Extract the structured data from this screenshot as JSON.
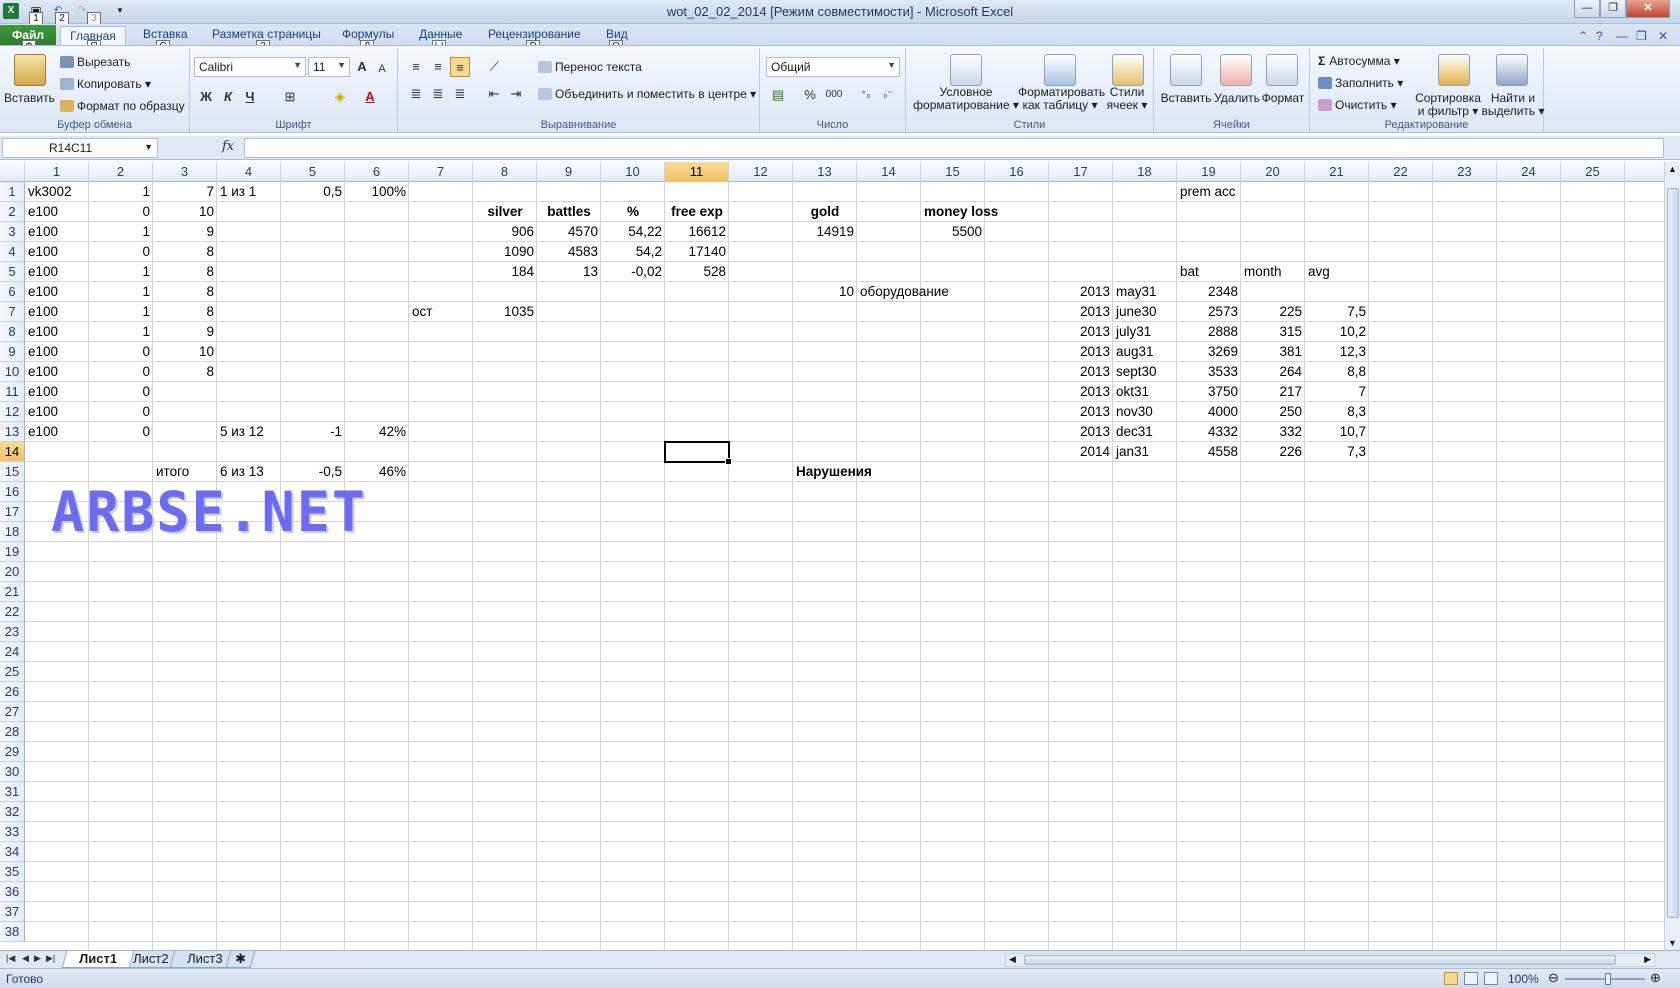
{
  "window": {
    "title": "wot_02_02_2014  [Режим совместимости]  -  Microsoft Excel",
    "qa_keytips": [
      "1",
      "2",
      "3"
    ],
    "minimize": "—",
    "restore": "❐",
    "close": "✕"
  },
  "tabs": [
    {
      "label": "Файл",
      "keytip": "Ф"
    },
    {
      "label": "Главная",
      "keytip": "Я"
    },
    {
      "label": "Вставка",
      "keytip": "С"
    },
    {
      "label": "Разметка страницы",
      "keytip": "З"
    },
    {
      "label": "Формулы",
      "keytip": "Л"
    },
    {
      "label": "Данные",
      "keytip": "Ы"
    },
    {
      "label": "Рецензирование",
      "keytip": "Р"
    },
    {
      "label": "Вид",
      "keytip": "О"
    }
  ],
  "ribbon": {
    "clipboard": {
      "paste": "Вставить",
      "cut": "Вырезать",
      "copy": "Копировать",
      "format_painter": "Формат по образцу",
      "label": "Буфер обмена"
    },
    "font": {
      "name": "Calibri",
      "size": "11",
      "bold": "Ж",
      "italic": "К",
      "underline": "Ч",
      "grow": "A",
      "shrink": "A",
      "font_color": "A",
      "label": "Шрифт"
    },
    "alignment": {
      "wrap": "Перенос текста",
      "merge": "Объединить и поместить в центре",
      "label": "Выравнивание"
    },
    "number": {
      "format": "Общий",
      "percent": "%",
      "thousands": "000",
      "label": "Число"
    },
    "styles": {
      "conditional": "Условное",
      "conditional2": "форматирование",
      "as_table": "Форматировать",
      "as_table2": "как таблицу",
      "cell_styles": "Стили",
      "cell_styles2": "ячеек",
      "label": "Стили"
    },
    "cells": {
      "insert": "Вставить",
      "delete": "Удалить",
      "format": "Формат",
      "label": "Ячейки"
    },
    "editing": {
      "autosum": "Автосумма",
      "fill": "Заполнить",
      "clear": "Очистить",
      "sort": "Сортировка",
      "sort2": "и фильтр",
      "find": "Найти и",
      "find2": "выделить",
      "label": "Редактирование"
    }
  },
  "formula_bar": {
    "name_box": "R14C11",
    "fx": "fx",
    "value": ""
  },
  "columns": [
    "1",
    "2",
    "3",
    "4",
    "5",
    "6",
    "7",
    "8",
    "9",
    "10",
    "11",
    "12",
    "13",
    "14",
    "15",
    "16",
    "17",
    "18",
    "19",
    "20",
    "21",
    "22",
    "23",
    "24",
    "25"
  ],
  "rows": [
    "1",
    "2",
    "3",
    "4",
    "5",
    "6",
    "7",
    "8",
    "9",
    "10",
    "11",
    "12",
    "13",
    "14",
    "15",
    "16",
    "17",
    "18",
    "19",
    "20",
    "21",
    "22",
    "23",
    "24",
    "25",
    "26",
    "27",
    "28",
    "29",
    "30",
    "31",
    "32",
    "33",
    "34",
    "35",
    "36",
    "37",
    "38"
  ],
  "cells": [
    {
      "r": 1,
      "c": 1,
      "v": "vk3002"
    },
    {
      "r": 1,
      "c": 2,
      "v": "1",
      "a": "r"
    },
    {
      "r": 1,
      "c": 3,
      "v": "7",
      "a": "r"
    },
    {
      "r": 1,
      "c": 4,
      "v": "1 из 1"
    },
    {
      "r": 1,
      "c": 5,
      "v": "0,5",
      "a": "r"
    },
    {
      "r": 1,
      "c": 6,
      "v": "100%",
      "a": "r"
    },
    {
      "r": 1,
      "c": 19,
      "v": "prem acc"
    },
    {
      "r": 2,
      "c": 1,
      "v": "e100"
    },
    {
      "r": 2,
      "c": 2,
      "v": "0",
      "a": "r"
    },
    {
      "r": 2,
      "c": 3,
      "v": "10",
      "a": "r"
    },
    {
      "r": 2,
      "c": 8,
      "v": "silver",
      "a": "c",
      "b": true
    },
    {
      "r": 2,
      "c": 9,
      "v": "battles",
      "a": "c",
      "b": true
    },
    {
      "r": 2,
      "c": 10,
      "v": "%",
      "a": "c",
      "b": true
    },
    {
      "r": 2,
      "c": 11,
      "v": "free exp",
      "a": "c",
      "b": true
    },
    {
      "r": 2,
      "c": 13,
      "v": "gold",
      "a": "c",
      "b": true
    },
    {
      "r": 2,
      "c": 15,
      "v": "money loss",
      "a": "c",
      "b": true
    },
    {
      "r": 3,
      "c": 1,
      "v": "e100"
    },
    {
      "r": 3,
      "c": 2,
      "v": "1",
      "a": "r"
    },
    {
      "r": 3,
      "c": 3,
      "v": "9",
      "a": "r"
    },
    {
      "r": 3,
      "c": 8,
      "v": "906",
      "a": "r"
    },
    {
      "r": 3,
      "c": 9,
      "v": "4570",
      "a": "r"
    },
    {
      "r": 3,
      "c": 10,
      "v": "54,22",
      "a": "r"
    },
    {
      "r": 3,
      "c": 11,
      "v": "16612",
      "a": "r"
    },
    {
      "r": 3,
      "c": 13,
      "v": "14919",
      "a": "r"
    },
    {
      "r": 3,
      "c": 15,
      "v": "5500",
      "a": "r"
    },
    {
      "r": 4,
      "c": 1,
      "v": "e100"
    },
    {
      "r": 4,
      "c": 2,
      "v": "0",
      "a": "r"
    },
    {
      "r": 4,
      "c": 3,
      "v": "8",
      "a": "r"
    },
    {
      "r": 4,
      "c": 8,
      "v": "1090",
      "a": "r"
    },
    {
      "r": 4,
      "c": 9,
      "v": "4583",
      "a": "r"
    },
    {
      "r": 4,
      "c": 10,
      "v": "54,2",
      "a": "r"
    },
    {
      "r": 4,
      "c": 11,
      "v": "17140",
      "a": "r"
    },
    {
      "r": 5,
      "c": 1,
      "v": "e100"
    },
    {
      "r": 5,
      "c": 2,
      "v": "1",
      "a": "r"
    },
    {
      "r": 5,
      "c": 3,
      "v": "8",
      "a": "r"
    },
    {
      "r": 5,
      "c": 8,
      "v": "184",
      "a": "r"
    },
    {
      "r": 5,
      "c": 9,
      "v": "13",
      "a": "r"
    },
    {
      "r": 5,
      "c": 10,
      "v": "-0,02",
      "a": "r"
    },
    {
      "r": 5,
      "c": 11,
      "v": "528",
      "a": "r"
    },
    {
      "r": 5,
      "c": 19,
      "v": "bat"
    },
    {
      "r": 5,
      "c": 20,
      "v": "month"
    },
    {
      "r": 5,
      "c": 21,
      "v": "avg"
    },
    {
      "r": 6,
      "c": 1,
      "v": "e100"
    },
    {
      "r": 6,
      "c": 2,
      "v": "1",
      "a": "r"
    },
    {
      "r": 6,
      "c": 3,
      "v": "8",
      "a": "r"
    },
    {
      "r": 6,
      "c": 13,
      "v": "10",
      "a": "r"
    },
    {
      "r": 6,
      "c": 14,
      "v": "оборудование"
    },
    {
      "r": 6,
      "c": 17,
      "v": "2013",
      "a": "r"
    },
    {
      "r": 6,
      "c": 18,
      "v": "may31"
    },
    {
      "r": 6,
      "c": 19,
      "v": "2348",
      "a": "r"
    },
    {
      "r": 7,
      "c": 1,
      "v": "e100"
    },
    {
      "r": 7,
      "c": 2,
      "v": "1",
      "a": "r"
    },
    {
      "r": 7,
      "c": 3,
      "v": "8",
      "a": "r"
    },
    {
      "r": 7,
      "c": 7,
      "v": "ост"
    },
    {
      "r": 7,
      "c": 8,
      "v": "1035",
      "a": "r"
    },
    {
      "r": 7,
      "c": 17,
      "v": "2013",
      "a": "r"
    },
    {
      "r": 7,
      "c": 18,
      "v": "june30"
    },
    {
      "r": 7,
      "c": 19,
      "v": "2573",
      "a": "r"
    },
    {
      "r": 7,
      "c": 20,
      "v": "225",
      "a": "r"
    },
    {
      "r": 7,
      "c": 21,
      "v": "7,5",
      "a": "r"
    },
    {
      "r": 8,
      "c": 1,
      "v": "e100"
    },
    {
      "r": 8,
      "c": 2,
      "v": "1",
      "a": "r"
    },
    {
      "r": 8,
      "c": 3,
      "v": "9",
      "a": "r"
    },
    {
      "r": 8,
      "c": 17,
      "v": "2013",
      "a": "r"
    },
    {
      "r": 8,
      "c": 18,
      "v": "july31"
    },
    {
      "r": 8,
      "c": 19,
      "v": "2888",
      "a": "r"
    },
    {
      "r": 8,
      "c": 20,
      "v": "315",
      "a": "r"
    },
    {
      "r": 8,
      "c": 21,
      "v": "10,2",
      "a": "r"
    },
    {
      "r": 9,
      "c": 1,
      "v": "e100"
    },
    {
      "r": 9,
      "c": 2,
      "v": "0",
      "a": "r"
    },
    {
      "r": 9,
      "c": 3,
      "v": "10",
      "a": "r"
    },
    {
      "r": 9,
      "c": 17,
      "v": "2013",
      "a": "r"
    },
    {
      "r": 9,
      "c": 18,
      "v": "aug31"
    },
    {
      "r": 9,
      "c": 19,
      "v": "3269",
      "a": "r"
    },
    {
      "r": 9,
      "c": 20,
      "v": "381",
      "a": "r"
    },
    {
      "r": 9,
      "c": 21,
      "v": "12,3",
      "a": "r"
    },
    {
      "r": 10,
      "c": 1,
      "v": "e100"
    },
    {
      "r": 10,
      "c": 2,
      "v": "0",
      "a": "r"
    },
    {
      "r": 10,
      "c": 3,
      "v": "8",
      "a": "r"
    },
    {
      "r": 10,
      "c": 17,
      "v": "2013",
      "a": "r"
    },
    {
      "r": 10,
      "c": 18,
      "v": "sept30"
    },
    {
      "r": 10,
      "c": 19,
      "v": "3533",
      "a": "r"
    },
    {
      "r": 10,
      "c": 20,
      "v": "264",
      "a": "r"
    },
    {
      "r": 10,
      "c": 21,
      "v": "8,8",
      "a": "r"
    },
    {
      "r": 11,
      "c": 1,
      "v": "e100"
    },
    {
      "r": 11,
      "c": 2,
      "v": "0",
      "a": "r"
    },
    {
      "r": 11,
      "c": 17,
      "v": "2013",
      "a": "r"
    },
    {
      "r": 11,
      "c": 18,
      "v": "okt31"
    },
    {
      "r": 11,
      "c": 19,
      "v": "3750",
      "a": "r"
    },
    {
      "r": 11,
      "c": 20,
      "v": "217",
      "a": "r"
    },
    {
      "r": 11,
      "c": 21,
      "v": "7",
      "a": "r"
    },
    {
      "r": 12,
      "c": 1,
      "v": "e100"
    },
    {
      "r": 12,
      "c": 2,
      "v": "0",
      "a": "r"
    },
    {
      "r": 12,
      "c": 17,
      "v": "2013",
      "a": "r"
    },
    {
      "r": 12,
      "c": 18,
      "v": "nov30"
    },
    {
      "r": 12,
      "c": 19,
      "v": "4000",
      "a": "r"
    },
    {
      "r": 12,
      "c": 20,
      "v": "250",
      "a": "r"
    },
    {
      "r": 12,
      "c": 21,
      "v": "8,3",
      "a": "r"
    },
    {
      "r": 13,
      "c": 1,
      "v": "e100"
    },
    {
      "r": 13,
      "c": 2,
      "v": "0",
      "a": "r"
    },
    {
      "r": 13,
      "c": 4,
      "v": "5 из 12"
    },
    {
      "r": 13,
      "c": 5,
      "v": "-1",
      "a": "r"
    },
    {
      "r": 13,
      "c": 6,
      "v": "42%",
      "a": "r"
    },
    {
      "r": 13,
      "c": 17,
      "v": "2013",
      "a": "r"
    },
    {
      "r": 13,
      "c": 18,
      "v": "dec31"
    },
    {
      "r": 13,
      "c": 19,
      "v": "4332",
      "a": "r"
    },
    {
      "r": 13,
      "c": 20,
      "v": "332",
      "a": "r"
    },
    {
      "r": 13,
      "c": 21,
      "v": "10,7",
      "a": "r"
    },
    {
      "r": 14,
      "c": 17,
      "v": "2014",
      "a": "r"
    },
    {
      "r": 14,
      "c": 18,
      "v": "jan31"
    },
    {
      "r": 14,
      "c": 19,
      "v": "4558",
      "a": "r"
    },
    {
      "r": 14,
      "c": 20,
      "v": "226",
      "a": "r"
    },
    {
      "r": 14,
      "c": 21,
      "v": "7,3",
      "a": "r"
    },
    {
      "r": 15,
      "c": 3,
      "v": "итого"
    },
    {
      "r": 15,
      "c": 4,
      "v": "6 из 13"
    },
    {
      "r": 15,
      "c": 5,
      "v": "-0,5",
      "a": "r"
    },
    {
      "r": 15,
      "c": 6,
      "v": "46%",
      "a": "r"
    },
    {
      "r": 15,
      "c": 13,
      "v": "Нарушения",
      "b": true
    }
  ],
  "active_cell": {
    "row": 14,
    "col": 11
  },
  "watermark": "ARBSE.NET",
  "sheets": [
    "Лист1",
    "Лист2",
    "Лист3"
  ],
  "active_sheet": 0,
  "status": {
    "ready": "Готово",
    "zoom": "100%"
  },
  "colors": {
    "file_tab": "#2a7c2a",
    "selected_header": "#f1c15f",
    "watermark": "#6c6cf0"
  }
}
